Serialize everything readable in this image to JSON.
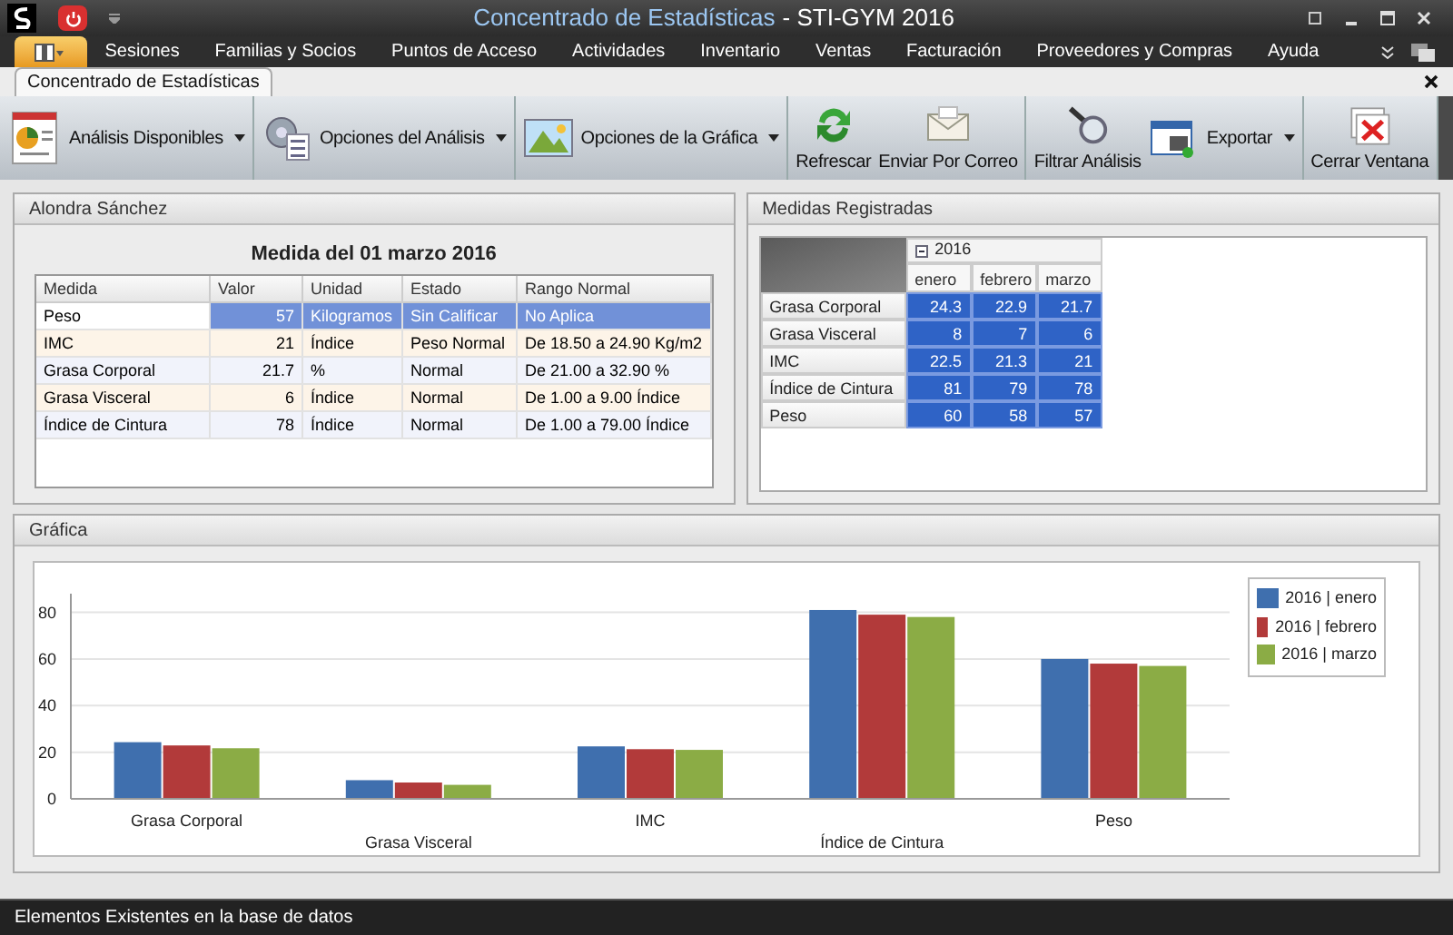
{
  "window": {
    "title": "Concentrado de Estadísticas",
    "app_name": "- STI-GYM 2016"
  },
  "menu": [
    "Sesiones",
    "Familias y Socios",
    "Puntos de Acceso",
    "Actividades",
    "Inventario",
    "Ventas",
    "Facturación",
    "Proveedores y Compras",
    "Ayuda"
  ],
  "document_tab": {
    "label": "Concentrado de Estadísticas"
  },
  "toolbar": [
    {
      "kind": "dropdown",
      "label": "Análisis Disponibles"
    },
    {
      "kind": "dropdown",
      "label": "Opciones del Análisis"
    },
    {
      "kind": "dropdown",
      "label": "Opciones de la Gráfica"
    },
    {
      "kind": "big",
      "label": "Refrescar"
    },
    {
      "kind": "big",
      "label": "Enviar Por Correo"
    },
    {
      "kind": "big",
      "label": "Filtrar Análisis"
    },
    {
      "kind": "dropdown",
      "label": "Exportar"
    },
    {
      "kind": "big",
      "label": "Cerrar Ventana"
    }
  ],
  "member_panel": {
    "title": "Alondra Sánchez",
    "caption": "Medida del  01 marzo 2016",
    "columns": [
      "Medida",
      "Valor",
      "Unidad",
      "Estado",
      "Rango Normal"
    ],
    "rows": [
      {
        "cells": [
          "Peso",
          "57",
          "Kilogramos",
          "Sin Calificar",
          "No Aplica"
        ],
        "selected": true
      },
      {
        "cells": [
          "IMC",
          "21",
          "Índice",
          "Peso Normal",
          "De 18.50 a 24.90 Kg/m2"
        ],
        "selected": false
      },
      {
        "cells": [
          "Grasa Corporal",
          "21.7",
          "%",
          "Normal",
          "De 21.00 a 32.90 %"
        ],
        "selected": false
      },
      {
        "cells": [
          "Grasa Visceral",
          "6",
          "Índice",
          "Normal",
          "De 1.00 a 9.00 Índice"
        ],
        "selected": false
      },
      {
        "cells": [
          "Índice de Cintura",
          "78",
          "Índice",
          "Normal",
          "De 1.00 a 79.00 Índice"
        ],
        "selected": false
      }
    ]
  },
  "pivot_panel": {
    "title": "Medidas Registradas",
    "group": "2016",
    "expanded": true,
    "columns": [
      "enero",
      "febrero",
      "marzo"
    ],
    "rows": [
      {
        "label": "Grasa Corporal",
        "values": [
          "24.3",
          "22.9",
          "21.7"
        ]
      },
      {
        "label": "Grasa Visceral",
        "values": [
          "8",
          "7",
          "6"
        ]
      },
      {
        "label": "IMC",
        "values": [
          "22.5",
          "21.3",
          "21"
        ]
      },
      {
        "label": "Índice de Cintura",
        "values": [
          "81",
          "79",
          "78"
        ]
      },
      {
        "label": "Peso",
        "values": [
          "60",
          "58",
          "57"
        ]
      }
    ]
  },
  "chart_panel": {
    "title": "Gráfica",
    "chart_data": {
      "type": "bar",
      "categories": [
        "Grasa Corporal",
        "Grasa Visceral",
        "IMC",
        "Índice de Cintura",
        "Peso"
      ],
      "series": [
        {
          "name": "2016 | enero",
          "color": "#3f6fae",
          "values": [
            24.3,
            8,
            22.5,
            81,
            60
          ]
        },
        {
          "name": "2016 | febrero",
          "color": "#b23a3a",
          "values": [
            22.9,
            7,
            21.3,
            79,
            58
          ]
        },
        {
          "name": "2016 | marzo",
          "color": "#8bac45",
          "values": [
            21.7,
            6,
            21,
            78,
            57
          ]
        }
      ],
      "ylim": [
        0,
        88
      ],
      "yticks": [
        0,
        20,
        40,
        60,
        80
      ],
      "grid": true
    }
  },
  "status_bar": "Elementos Existentes en la base de datos"
}
